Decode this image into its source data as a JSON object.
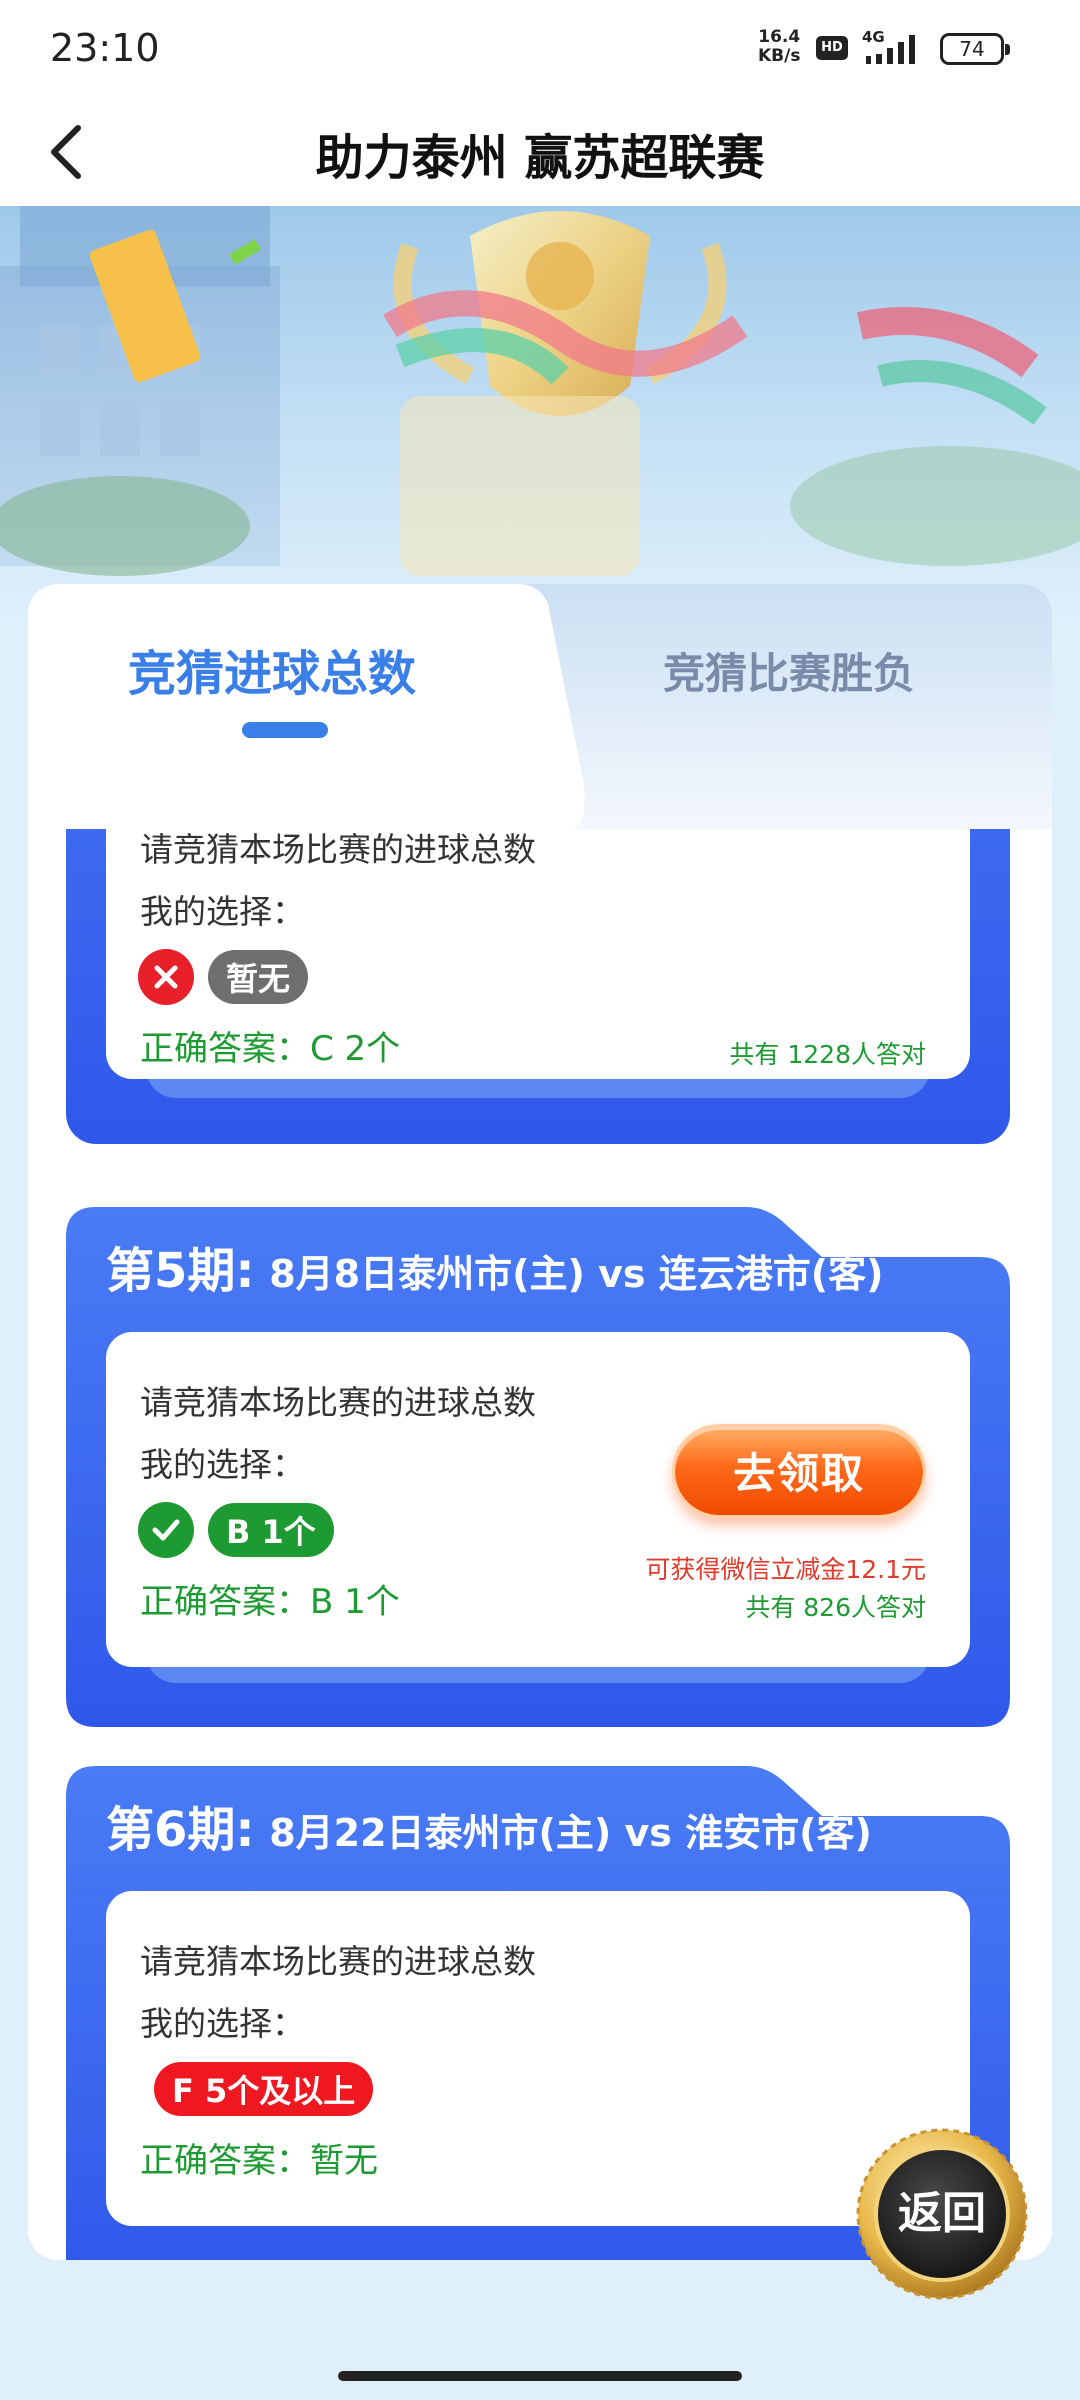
{
  "status_bar": {
    "time": "23:10",
    "net_speed_value": "16.4",
    "net_speed_unit": "KB/s",
    "hd": "HD",
    "network": "4G",
    "battery": "74"
  },
  "header": {
    "title": "助力泰州 赢苏超联赛",
    "back_icon": "chevron-left-icon"
  },
  "tabs": [
    {
      "label": "竞猜进球总数",
      "active": true
    },
    {
      "label": "竞猜比赛胜负",
      "active": false
    }
  ],
  "periods": [
    {
      "question": "请竞猜本场比赛的进球总数",
      "my_choice_label": "我的选择：",
      "result_icon": "wrong-icon",
      "choice": "暂无",
      "answer": "正确答案：C 2个",
      "count": "共有 1228人答对"
    },
    {
      "period_label": "第5期:",
      "match": "8月8日泰州市(主) vs 连云港市(客)",
      "question": "请竞猜本场比赛的进球总数",
      "my_choice_label": "我的选择：",
      "result_icon": "check-icon",
      "choice": "B 1个",
      "answer": "正确答案：B 1个",
      "claim_button": "去领取",
      "reward": "可获得微信立减金12.1元",
      "count": "共有 826人答对"
    },
    {
      "period_label": "第6期:",
      "match": "8月22日泰州市(主) vs 淮安市(客)",
      "question": "请竞猜本场比赛的进球总数",
      "my_choice_label": "我的选择：",
      "choice": "F 5个及以上",
      "answer": "正确答案：暂无"
    }
  ],
  "return_button": "返回",
  "colors": {
    "primary_blue": "#3a6cf0",
    "correct_green": "#1e9a32",
    "wrong_red": "#e8202a",
    "claim_orange": "#ff6a1a"
  }
}
